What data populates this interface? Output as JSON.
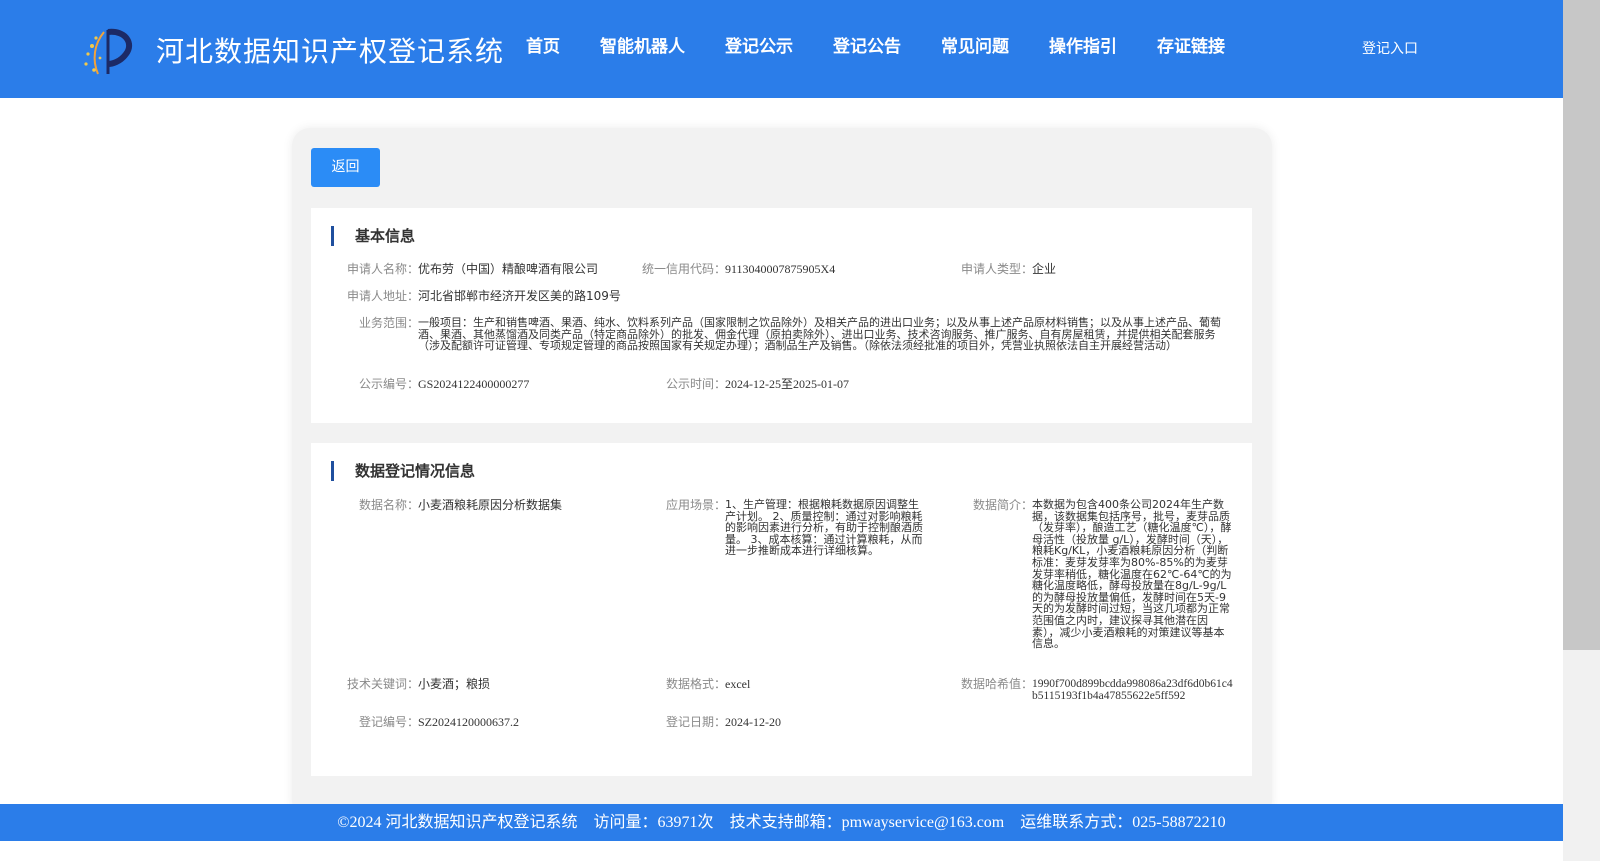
{
  "header": {
    "title": "河北数据知识产权登记系统",
    "nav": [
      "首页",
      "智能机器人",
      "登记公示",
      "登记公告",
      "常见问题",
      "操作指引",
      "存证链接"
    ],
    "login": "登记入口",
    "colors": {
      "primary": "#2b7de9",
      "button": "#2b8cf6"
    }
  },
  "actions": {
    "back": "返回"
  },
  "basic": {
    "title": "基本信息",
    "applicant_name_label": "申请人名称：",
    "applicant_name": "优布劳（中国）精酿啤酒有限公司",
    "credit_code_label": "统一信用代码：",
    "credit_code": "9113040007875905X4",
    "applicant_type_label": "申请人类型：",
    "applicant_type": "企业",
    "address_label": "申请人地址：",
    "address": "河北省邯郸市经济开发区美的路109号",
    "scope_label": "业务范围：",
    "scope": "一般项目：生产和销售啤酒、果酒、纯水、饮料系列产品（国家限制之饮品除外）及相关产品的进出口业务；以及从事上述产品原材料销售；以及从事上述产品、葡萄酒、果酒、其他蒸馏酒及同类产品（特定商品除外）的批发、佣金代理（原拍卖除外）、进出口业务、技术咨询服务、推广服务、自有房屋租赁，并提供相关配套服务（涉及配额许可证管理、专项规定管理的商品按照国家有关规定办理）；酒制品生产及销售。（除依法须经批准的项目外，凭营业执照依法自主开展经营活动）",
    "notice_no_label": "公示编号：",
    "notice_no": "GS2024122400000277",
    "notice_time_label": "公示时间：",
    "notice_time": "2024-12-25至2025-01-07"
  },
  "registration": {
    "title": "数据登记情况信息",
    "data_name_label": "数据名称：",
    "data_name": "小麦酒粮耗原因分析数据集",
    "scenario_label": "应用场景：",
    "scenario": "1、生产管理：根据粮耗数据原因调整生产计划。 2、质量控制：通过对影响粮耗的影响因素进行分析，有助于控制酿酒质量。 3、成本核算：通过计算粮耗，从而进一步推断成本进行详细核算。",
    "intro_label": "数据简介：",
    "intro": "本数据为包含400条公司2024年生产数据，该数据集包括序号，批号，麦芽品质（发芽率），酿造工艺（糖化温度℃），酵母活性（投放量 g/L），发酵时间（天），粮耗Kg/KL，小麦酒粮耗原因分析（判断标准：麦芽发芽率为80%-85%的为麦芽发芽率稍低，糖化温度在62℃-64℃的为糖化温度略低，酵母投放量在8g/L-9g/L的为酵母投放量偏低，发酵时间在5天-9天的为发酵时间过短，当这几项都为正常范围值之内时，建议探寻其他潜在因素），减少小麦酒粮耗的对策建议等基本信息。",
    "keywords_label": "技术关键词：",
    "keywords": "小麦酒；粮损",
    "format_label": "数据格式：",
    "format": "excel",
    "hash_label": "数据哈希值：",
    "hash": "1990f700d899bcdda998086a23df6d0b61c4b5115193f1b4a47855622e5ff592",
    "reg_no_label": "登记编号：",
    "reg_no": "SZ2024120000637.2",
    "reg_date_label": "登记日期：",
    "reg_date": "2024-12-20"
  },
  "footer": {
    "copyright": "©2024 河北数据知识产权登记系统",
    "visits": "访问量：63971次",
    "email": "技术支持邮箱：pmwayservice@163.com",
    "phone": "运维联系方式：025-58872210"
  }
}
